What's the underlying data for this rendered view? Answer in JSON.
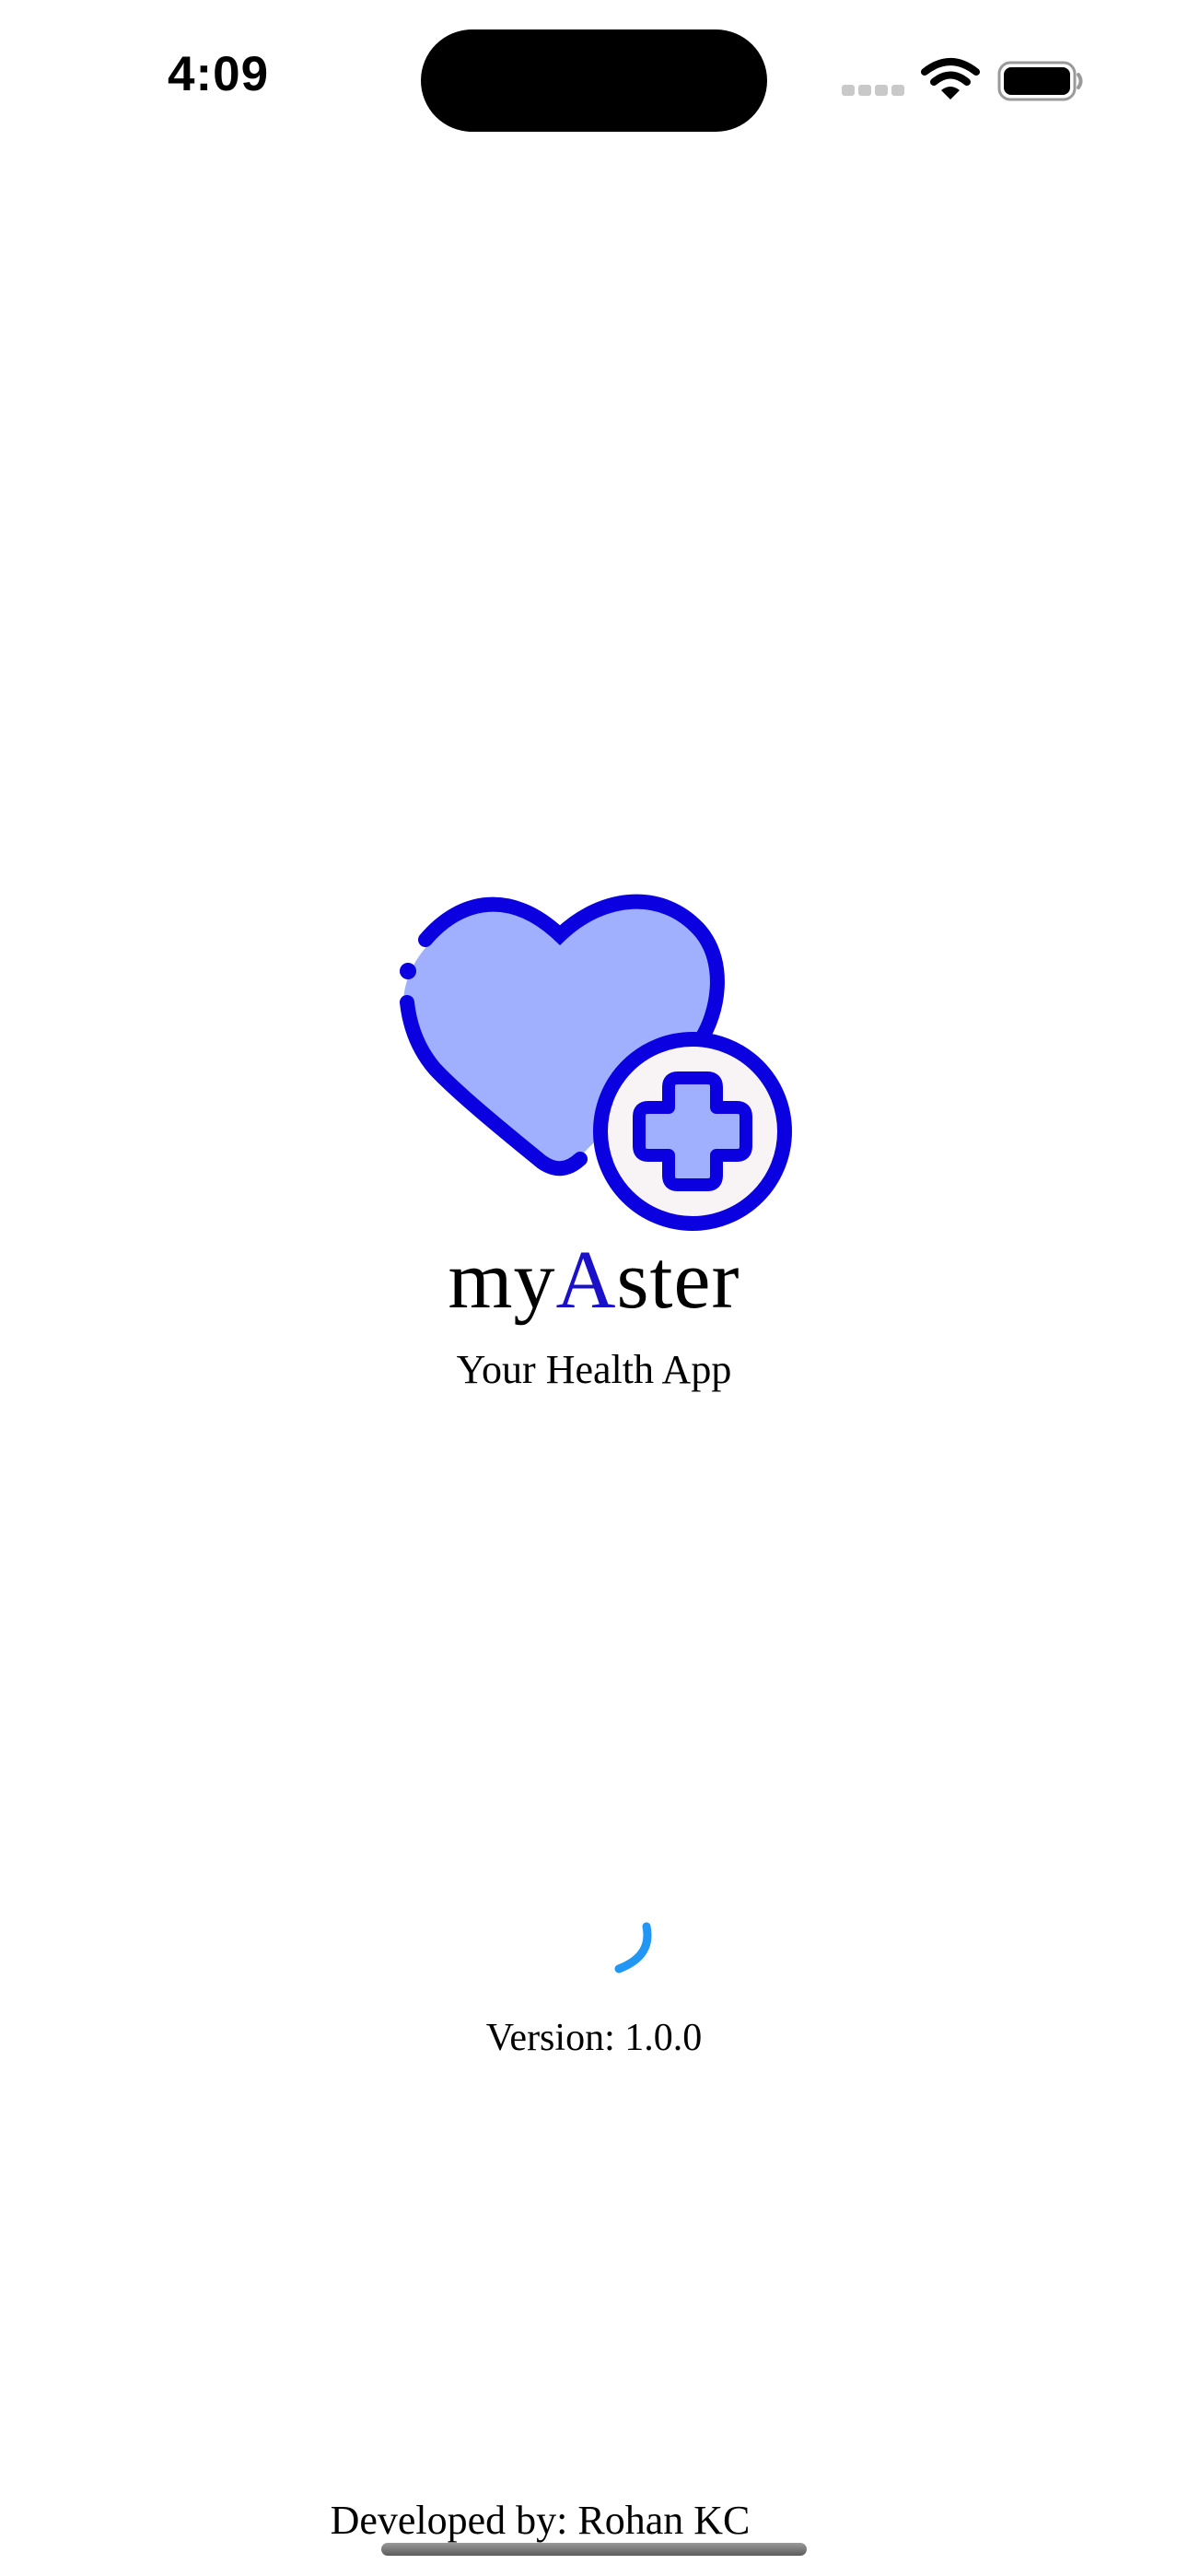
{
  "status_bar": {
    "time": "4:09",
    "icons": [
      "signal-icon",
      "wifi-icon",
      "battery-icon"
    ]
  },
  "splash": {
    "logo_icon": "heart-plus-icon",
    "title_prefix": "my",
    "title_accent": "A",
    "title_suffix": "ster",
    "tagline": "Your Health App",
    "version": "Version: 1.0.0",
    "developer": "Developed by: Rohan KC"
  },
  "colors": {
    "accent": "#1a10c9",
    "logo_stroke": "#0a00e0",
    "logo_fill": "#a0b0ff",
    "spinner": "#2196f3"
  }
}
